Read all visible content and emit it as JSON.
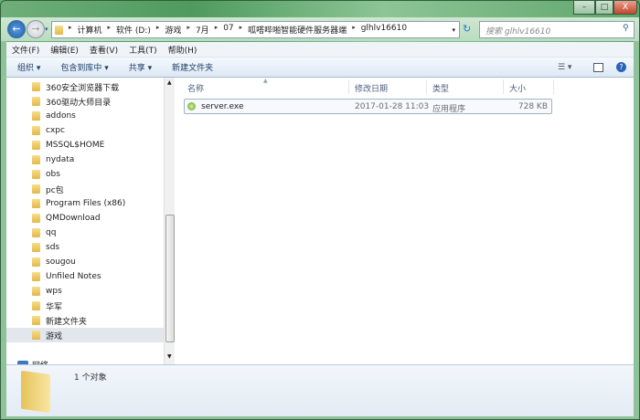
{
  "window": {
    "minimize": "–",
    "maximize": "□",
    "close": "X"
  },
  "address": {
    "crumbs": [
      "计算机",
      "软件 (D:)",
      "游戏",
      "7月",
      "07",
      "呱嗒哔啪智能硬件服务器端",
      "glhlv16610"
    ],
    "search_placeholder": "搜索 glhlv16610"
  },
  "menu": [
    "文件(F)",
    "编辑(E)",
    "查看(V)",
    "工具(T)",
    "帮助(H)"
  ],
  "toolbar": {
    "organize": "组织 ▾",
    "include": "包含到库中 ▾",
    "share": "共享 ▾",
    "new_folder": "新建文件夹"
  },
  "sidebar": {
    "items": [
      "360安全浏览器下载",
      "360驱动大师目录",
      "addons",
      "cxpc",
      "MSSQL$HOME",
      "nydata",
      "obs",
      "pc包",
      "Program Files (x86)",
      "QMDownload",
      "qq",
      "sds",
      "sougou",
      "Unfiled Notes",
      "wps",
      "华军",
      "新建文件夹",
      "游戏"
    ],
    "network": "网络"
  },
  "columns": {
    "name": "名称",
    "modified": "修改日期",
    "type": "类型",
    "size": "大小"
  },
  "files": [
    {
      "name": "server.exe",
      "modified": "2017-01-28 11:03",
      "type": "应用程序",
      "size": "728 KB"
    }
  ],
  "status": {
    "count": "1 个对象"
  }
}
